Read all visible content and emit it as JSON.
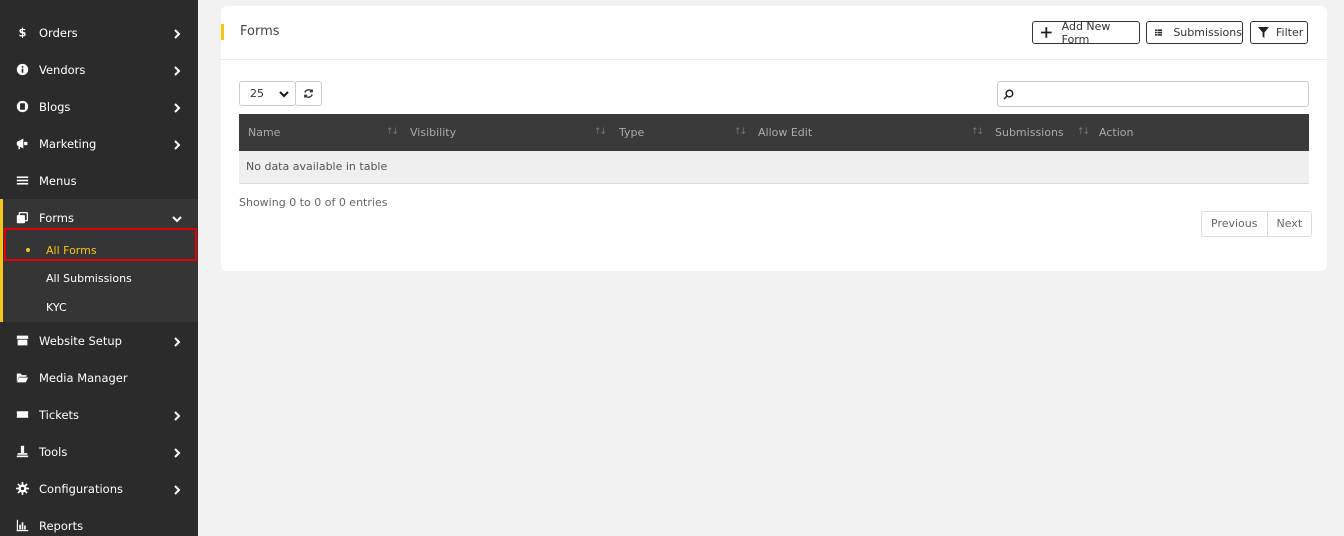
{
  "sidebar": {
    "items_top": [
      {
        "label": "Orders",
        "icon": "dollar-icon",
        "has_chevron": true
      },
      {
        "label": "Vendors",
        "icon": "info-icon",
        "has_chevron": true
      },
      {
        "label": "Blogs",
        "icon": "blog-icon",
        "has_chevron": true
      },
      {
        "label": "Marketing",
        "icon": "megaphone-icon",
        "has_chevron": true
      },
      {
        "label": "Menus",
        "icon": "menu-lines-icon",
        "has_chevron": false
      }
    ],
    "forms_group": {
      "label": "Forms",
      "icon": "forms-icon",
      "subitems": [
        "All Forms",
        "All Submissions",
        "KYC"
      ],
      "active": "All Forms"
    },
    "items_bottom": [
      {
        "label": "Website Setup",
        "icon": "storefront-icon",
        "has_chevron": true
      },
      {
        "label": "Media Manager",
        "icon": "folder-open-icon",
        "has_chevron": false
      },
      {
        "label": "Tickets",
        "icon": "ticket-icon",
        "has_chevron": true
      },
      {
        "label": "Tools",
        "icon": "tools-icon",
        "has_chevron": true
      },
      {
        "label": "Configurations",
        "icon": "gear-icon",
        "has_chevron": true
      },
      {
        "label": "Reports",
        "icon": "bar-chart-icon",
        "has_chevron": false
      }
    ]
  },
  "header": {
    "title": "Forms",
    "add_label": "Add New Form",
    "submissions_label": "Submissions",
    "filter_label": "Filter"
  },
  "table": {
    "page_length": "25",
    "search_placeholder": "",
    "columns": [
      "Name",
      "Visibility",
      "Type",
      "Allow Edit",
      "Submissions",
      "Action"
    ],
    "empty_message": "No data available in table",
    "info": "Showing 0 to 0 of 0 entries",
    "prev_label": "Previous",
    "next_label": "Next"
  },
  "colors": {
    "sidebar_bg": "#2b2b2b",
    "accent": "#f5c518",
    "highlight": "#e00000",
    "table_header_bg": "#3a3a3a"
  }
}
